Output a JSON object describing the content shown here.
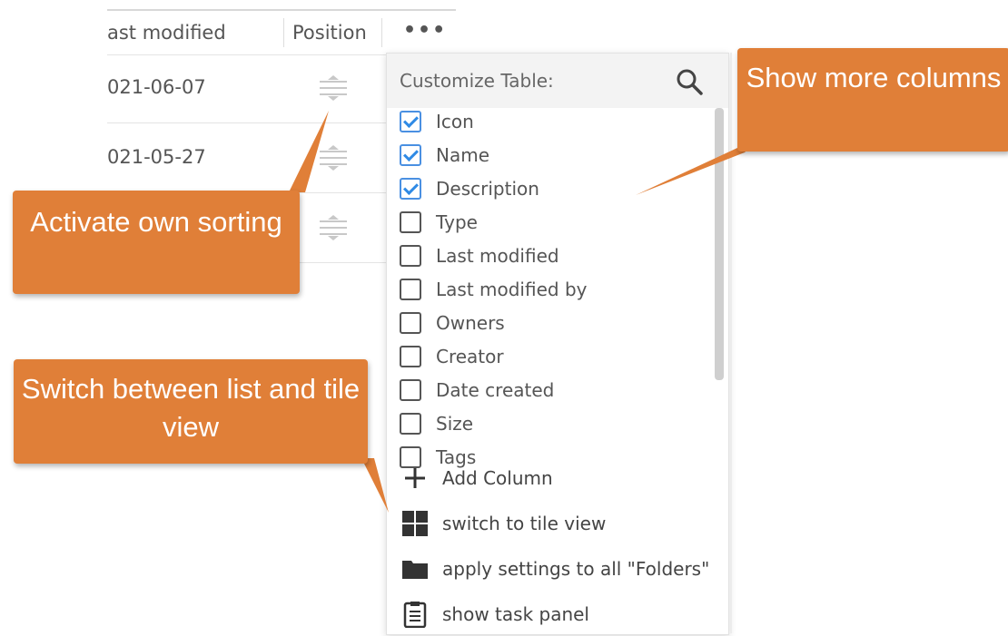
{
  "table": {
    "headers": {
      "modified": "ast modified",
      "position": "Position",
      "more": "•••"
    },
    "rows": [
      {
        "date": "021-06-07"
      },
      {
        "date": "021-05-27"
      },
      {
        "date": ""
      }
    ]
  },
  "panel": {
    "title": "Customize Table:",
    "columns": [
      {
        "label": "Icon",
        "checked": true
      },
      {
        "label": "Name",
        "checked": true
      },
      {
        "label": "Description",
        "checked": true
      },
      {
        "label": "Type",
        "checked": false
      },
      {
        "label": "Last modified",
        "checked": false
      },
      {
        "label": "Last modified by",
        "checked": false
      },
      {
        "label": "Owners",
        "checked": false
      },
      {
        "label": "Creator",
        "checked": false
      },
      {
        "label": "Date created",
        "checked": false
      },
      {
        "label": "Size",
        "checked": false
      },
      {
        "label": "Tags",
        "checked": false
      }
    ],
    "actions": [
      {
        "label": "Add Column",
        "icon": "plus-icon"
      },
      {
        "label": "switch to tile view",
        "icon": "grid-icon"
      },
      {
        "label": "apply settings to all \"Folders\"",
        "icon": "folder-icon"
      },
      {
        "label": "show task panel",
        "icon": "clipboard-icon"
      }
    ]
  },
  "callouts": {
    "sorting": "Activate own sorting",
    "columns": "Show more columns",
    "view": "Switch between list and tile view"
  },
  "colors": {
    "callout": "#e07f38",
    "check": "#2f8ae5"
  }
}
